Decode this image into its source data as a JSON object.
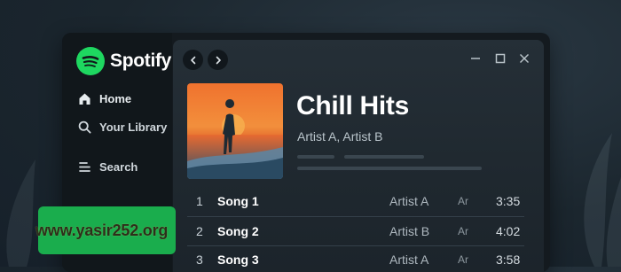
{
  "app": {
    "name": "Spotify",
    "brand_color": "#1ed760"
  },
  "sidebar": {
    "items": [
      {
        "label": "Home",
        "icon": "home-icon"
      },
      {
        "label": "Your Library",
        "icon": "search-icon"
      },
      {
        "label": "Search",
        "icon": "menu-icon"
      }
    ]
  },
  "toolbar": {
    "back_icon": "chevron-left-icon",
    "forward_icon": "chevron-right-icon"
  },
  "window_controls": [
    "minimize-icon",
    "maximize-icon",
    "close-icon"
  ],
  "playlist": {
    "title": "Chill Hits",
    "artists": "Artist A, Artist B"
  },
  "tracks": [
    {
      "num": "1",
      "title": "Song 1",
      "artist": "Artist A",
      "album": "Ar",
      "duration": "3:35"
    },
    {
      "num": "2",
      "title": "Song 2",
      "artist": "Artist B",
      "album": "Ar",
      "duration": "4:02"
    },
    {
      "num": "3",
      "title": "Song 3",
      "artist": "Artist A",
      "album": "Ar",
      "duration": "3:58"
    }
  ],
  "watermark": {
    "text": "www.yasir252.org"
  }
}
